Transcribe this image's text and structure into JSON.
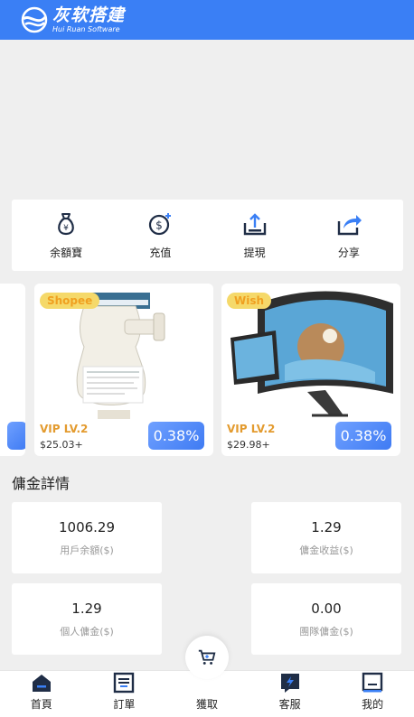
{
  "brand": {
    "name_cn": "灰软搭建",
    "name_en": "Hui Ruan Software"
  },
  "actions": [
    {
      "label": "余額寶",
      "icon": "money-bag-icon"
    },
    {
      "label": "充值",
      "icon": "coin-plus-icon"
    },
    {
      "label": "提現",
      "icon": "upload-tray-icon"
    },
    {
      "label": "分享",
      "icon": "share-icon"
    }
  ],
  "products": [
    {
      "store": "Shopee",
      "vip": "VIP LV.2",
      "price": "$25.03+",
      "rate": "0.38%"
    },
    {
      "store": "Wish",
      "vip": "VIP LV.2",
      "price": "$29.98+",
      "rate": "0.38%"
    }
  ],
  "section_title": "傭金詳情",
  "stats": [
    {
      "value": "1006.29",
      "label": "用戶余額($)"
    },
    {
      "value": "1.29",
      "label": "傭金收益($)"
    },
    {
      "value": "1.29",
      "label": "個人傭金($)"
    },
    {
      "value": "0.00",
      "label": "團隊傭金($)"
    }
  ],
  "nav": [
    {
      "label": "首頁",
      "icon": "home-icon"
    },
    {
      "label": "訂單",
      "icon": "orders-icon"
    },
    {
      "label": "獲取",
      "icon": "cart-icon"
    },
    {
      "label": "客服",
      "icon": "service-icon"
    },
    {
      "label": "我的",
      "icon": "profile-icon"
    }
  ],
  "colors": {
    "primary": "#3a7ff5",
    "vip": "#e39b2f",
    "background": "#efefef",
    "dark_icon": "#1f2d46"
  }
}
